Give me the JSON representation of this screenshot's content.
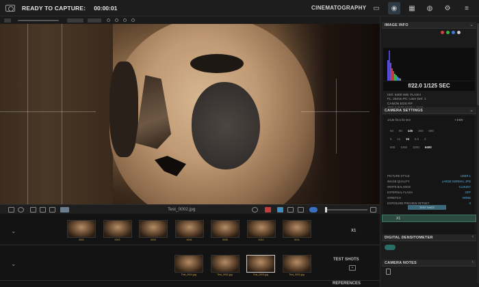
{
  "topbar": {
    "status": "READY TO CAPTURE:",
    "timer": "00:00:01",
    "mode": "CINEMATOGRAPHY"
  },
  "viewer": {
    "filename": "Test_0002.jpg"
  },
  "filmstrip": {
    "row1": {
      "label": "X1",
      "thumbs": [
        "0001",
        "0002",
        "0003",
        "0004",
        "0005",
        "0010",
        "0011"
      ]
    },
    "row2": {
      "label": "TEST SHOTS",
      "thumbs": [
        "Test_0001.jpg",
        "Test_0002.jpg",
        "Test_0003.jpg",
        "Test_0004.jpg"
      ],
      "selected_index": 2
    },
    "row3": {
      "label": "REFERENCES"
    }
  },
  "panel": {
    "image_info": {
      "title": "IMAGE INFO",
      "exposure": "f/22.0   1/125 SEC",
      "meta": [
        "ISO: 6400   WB: FLASH",
        "FL: 25mm   PC: User Def. 1",
        "CANON EOS RP",
        "JPG 2.0MB 6240 x 4160"
      ]
    },
    "camera_settings": {
      "title": "CAMERA SETTINGS",
      "header_line": "1/125  f/3.5  f/4  ISO",
      "ev_value": "+ 0 EV",
      "aperture_row": [
        "60",
        "90",
        "125",
        "250",
        "500"
      ],
      "fstop_row": [
        "8",
        "11",
        "16",
        "5.6",
        "4"
      ],
      "iso_row": [
        "800",
        "1250",
        "3200",
        "6400"
      ],
      "settings": [
        {
          "label": "PICTURE STYLE",
          "value": "USER 1"
        },
        {
          "label": "IMAGE QUALITY",
          "value": "LARGE NORMAL JPG"
        },
        {
          "label": "WHITE BALANCE",
          "value": "CLOUDY"
        },
        {
          "label": "EXTERNAL FLASH",
          "value": "OFF"
        },
        {
          "label": "STRETCH",
          "value": "NONE"
        },
        {
          "label": "EXPOSURE PREVIEW OFFSET",
          "value": "0"
        }
      ],
      "test_button": "TEST SHOT",
      "x1_label": "X1"
    },
    "densitometer": {
      "title": "DIGITAL DENSITOMETER"
    },
    "camera_notes": {
      "title": "CAMERA NOTES"
    }
  },
  "colors": {
    "accent": "#5ab6e6",
    "thumb_caption": "#d1a64b",
    "channel_dots": [
      "#d84040",
      "#3cb34a",
      "#3d7bd8",
      "#c8c8c8"
    ]
  }
}
